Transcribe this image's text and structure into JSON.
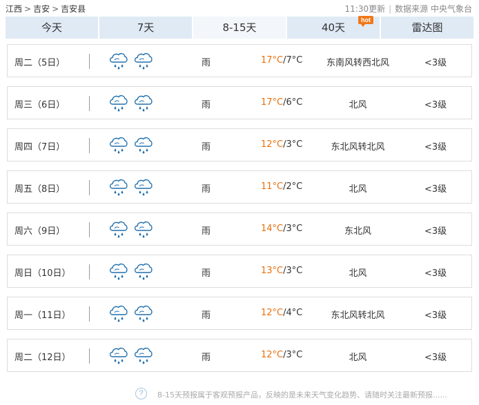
{
  "breadcrumb": {
    "items": [
      "江西",
      "吉安",
      "吉安县"
    ],
    "separator": ">"
  },
  "header": {
    "updated": "11:30更新",
    "source": "数据来源 中央气象台"
  },
  "tabs": [
    {
      "label": "今天"
    },
    {
      "label": "7天"
    },
    {
      "label": "8-15天"
    },
    {
      "label": "40天",
      "badge": "hot"
    },
    {
      "label": "雷达图"
    }
  ],
  "active_tab": "8-15天",
  "forecast": [
    {
      "day": "周二（5日）",
      "icons": [
        "cloud-rain-icon",
        "cloud-rain-icon"
      ],
      "weather": "雨",
      "high": "17°C",
      "low": "7°C",
      "wind": "东南风转西北风",
      "level": "<3级"
    },
    {
      "day": "周三（6日）",
      "icons": [
        "cloud-rain-icon",
        "cloud-rain-icon"
      ],
      "weather": "雨",
      "high": "17°C",
      "low": "6°C",
      "wind": "北风",
      "level": "<3级"
    },
    {
      "day": "周四（7日）",
      "icons": [
        "cloud-rain-icon",
        "cloud-rain-icon"
      ],
      "weather": "雨",
      "high": "12°C",
      "low": "3°C",
      "wind": "东北风转北风",
      "level": "<3级"
    },
    {
      "day": "周五（8日）",
      "icons": [
        "cloud-rain-icon",
        "cloud-rain-icon"
      ],
      "weather": "雨",
      "high": "11°C",
      "low": "2°C",
      "wind": "北风",
      "level": "<3级"
    },
    {
      "day": "周六（9日）",
      "icons": [
        "cloud-rain-icon",
        "cloud-rain-icon"
      ],
      "weather": "雨",
      "high": "14°C",
      "low": "3°C",
      "wind": "东北风",
      "level": "<3级"
    },
    {
      "day": "周日（10日）",
      "icons": [
        "cloud-rain-icon",
        "cloud-rain-icon"
      ],
      "weather": "雨",
      "high": "13°C",
      "low": "3°C",
      "wind": "北风",
      "level": "<3级"
    },
    {
      "day": "周一（11日）",
      "icons": [
        "cloud-rain-icon",
        "cloud-rain-icon"
      ],
      "weather": "雨",
      "high": "12°C",
      "low": "4°C",
      "wind": "东北风转北风",
      "level": "<3级"
    },
    {
      "day": "周二（12日）",
      "icons": [
        "cloud-rain-icon",
        "cloud-rain-icon"
      ],
      "weather": "雨",
      "high": "12°C",
      "low": "3°C",
      "wind": "北风",
      "level": "<3级"
    }
  ],
  "notice": {
    "icon": "question-icon",
    "icon_glyph": "?",
    "text": "8-15天预报属于客观预报产品，反映的是未来天气变化趋势、请随时关注最新预报......"
  },
  "colors": {
    "high_temp": "#e8700e",
    "tab_bg": "#dfeaf5",
    "tab_active_bg": "#f3f7fb",
    "icon": "#1f6fae",
    "hot_badge": "#f07818"
  }
}
